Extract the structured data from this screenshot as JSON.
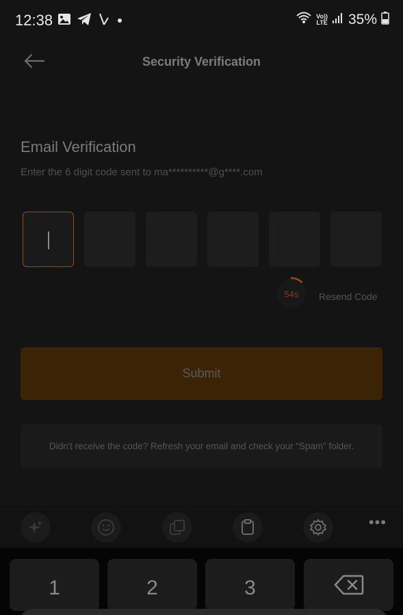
{
  "status_bar": {
    "time": "12:38",
    "network_label_top": "Vo))",
    "network_label_bottom": "LTE",
    "battery": "35%"
  },
  "header": {
    "title": "Security Verification"
  },
  "verification": {
    "title": "Email Verification",
    "subtitle": "Enter the 6 digit code sent to ma**********@g****.com",
    "code_length": 6,
    "timer": "54s",
    "resend_label": "Resend Code"
  },
  "submit_label": "Submit",
  "info_text": "Didn't receive the code? Refresh your email and check your “Spam” folder.",
  "keyboard": {
    "keys": [
      "1",
      "2",
      "3"
    ]
  },
  "colors": {
    "background": "#141414",
    "accent": "#e67e22",
    "submit_bg": "#3b2306"
  }
}
